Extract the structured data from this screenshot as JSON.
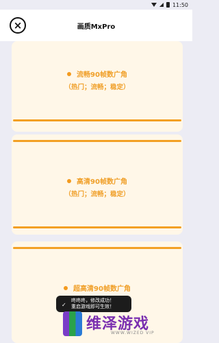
{
  "status": {
    "time": "11:50"
  },
  "header": {
    "close_icon": "×",
    "title": "画质MxPro"
  },
  "options": [
    {
      "title": "流畅90帧数广角",
      "subtitle": "（热门；流畅；稳定）"
    },
    {
      "title": "高清90帧数广角",
      "subtitle": "（热门；流畅；稳定）"
    },
    {
      "title": "超高清90帧数广角"
    }
  ],
  "toast": {
    "line1": "咚咚咚，修改成功！",
    "line2": "重启游戏即可生效！"
  },
  "watermark": {
    "text": "维泽游戏",
    "sub": "WWW.WIZED VIP"
  },
  "colors": {
    "accent": "#f3a024",
    "card_bg": "#fff7e8",
    "page_bg": "#ececf4"
  }
}
